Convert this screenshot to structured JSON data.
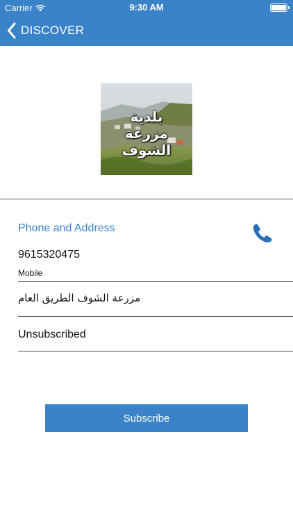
{
  "status_bar": {
    "carrier": "Carrier",
    "time": "9:30 AM"
  },
  "nav": {
    "back_label": "DISCOVER"
  },
  "hero": {
    "title_line1": "بلدية",
    "title_line2": "مزرعة الشوف"
  },
  "contact": {
    "section_title": "Phone and Address",
    "phone_number": "9615320475",
    "phone_type": "Mobile",
    "address": "مزرعة الشوف الطريق العام",
    "subscription_status": "Unsubscribed"
  },
  "actions": {
    "subscribe_label": "Subscribe"
  },
  "colors": {
    "accent": "#3b83c8"
  }
}
